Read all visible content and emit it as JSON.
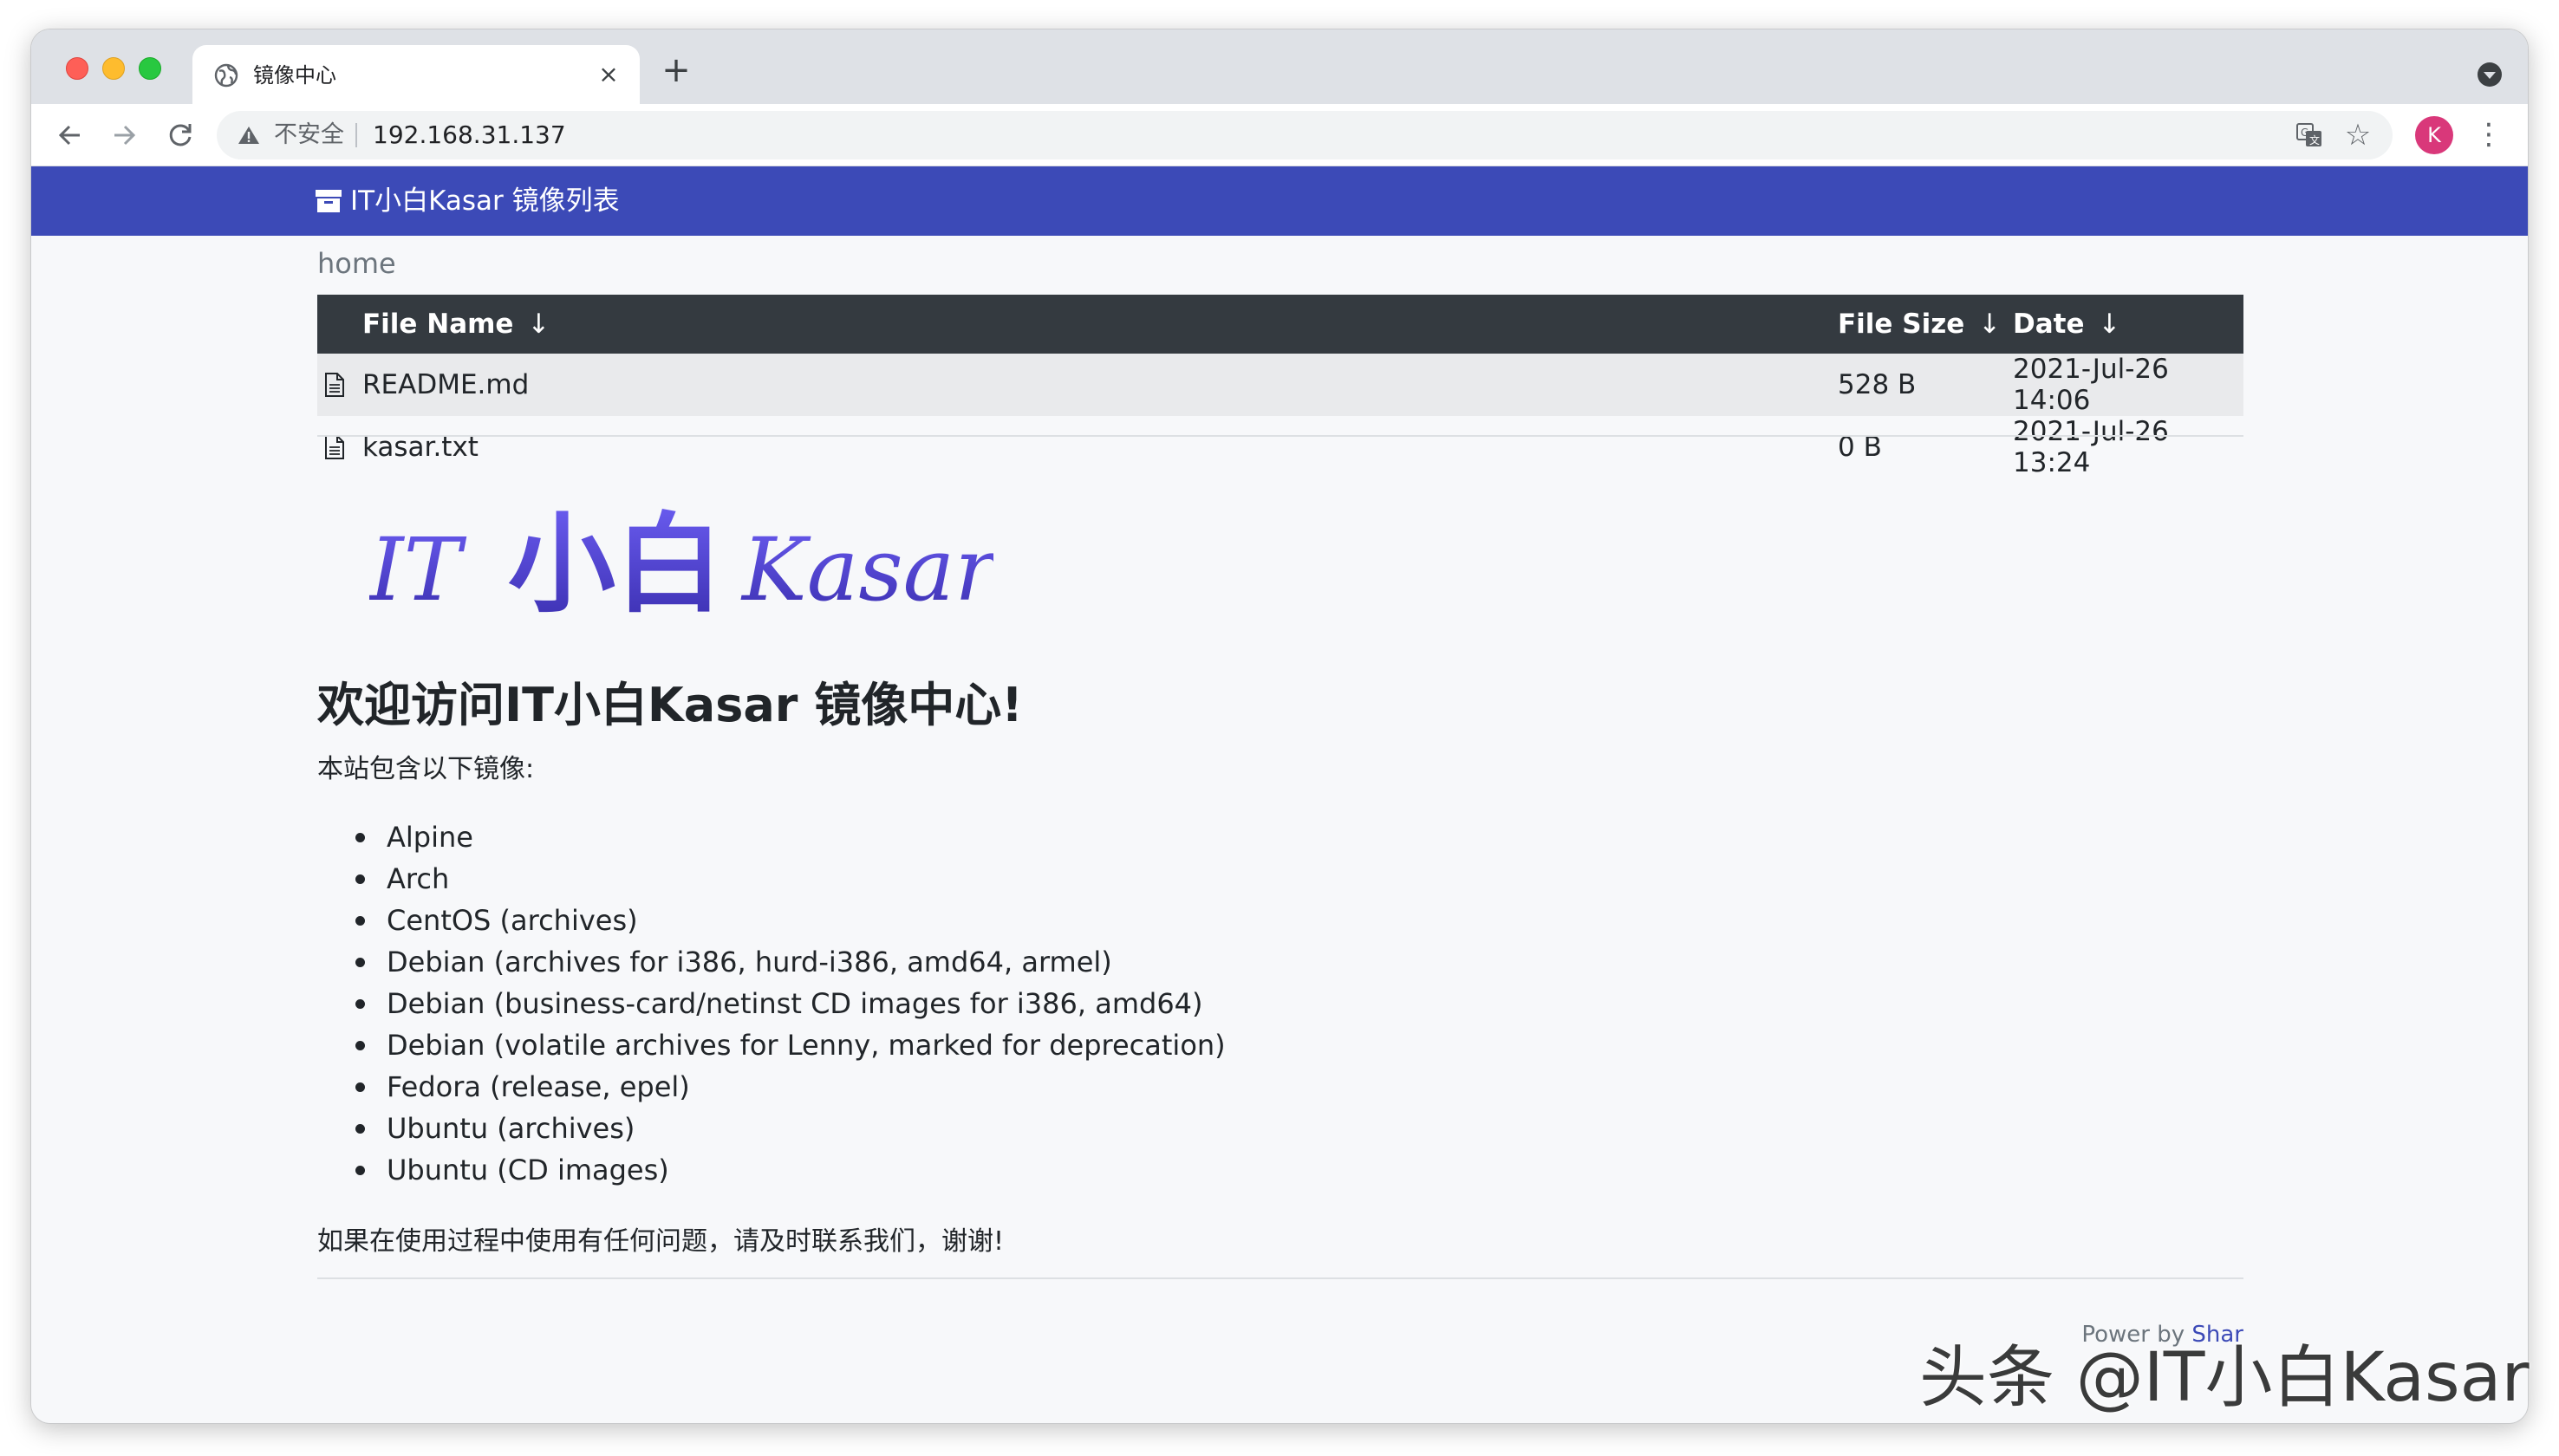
{
  "browser": {
    "tab_title": "镜像中心",
    "tab_close": "×",
    "new_tab": "+",
    "security_label": "不安全",
    "url": "192.168.31.137",
    "avatar_letter": "K",
    "avatar_color": "#d9387a"
  },
  "navbar": {
    "brand": "IT小白Kasar 镜像列表",
    "color": "#3c4ab7"
  },
  "breadcrumb": "home",
  "table": {
    "headers": {
      "name": "File Name",
      "size": "File Size",
      "date": "Date",
      "sort_arrow": "↓"
    },
    "rows": [
      {
        "name": "README.md",
        "size": "528 B",
        "date": "2021-Jul-26 14:06"
      },
      {
        "name": "kasar.txt",
        "size": "0 B",
        "date": "2021-Jul-26 13:24"
      }
    ]
  },
  "logo": {
    "part1": "IT",
    "part2": "小白",
    "part3": "Kasar"
  },
  "content": {
    "welcome": "欢迎访问IT小白Kasar 镜像中心!",
    "intro": "本站包含以下镜像:",
    "mirrors": [
      "Alpine",
      "Arch",
      "CentOS (archives)",
      "Debian (archives for i386, hurd-i386, amd64, armel)",
      "Debian (business-card/netinst CD images for i386, amd64)",
      "Debian (volatile archives for Lenny, marked for deprecation)",
      "Fedora (release, epel)",
      "Ubuntu (archives)",
      "Ubuntu (CD images)"
    ],
    "contact": "如果在使用过程中使用有任何问题，请及时联系我们，谢谢!"
  },
  "footer": {
    "prefix": "Power by ",
    "link": "Shar"
  },
  "watermark": "头条 @IT小白Kasar"
}
